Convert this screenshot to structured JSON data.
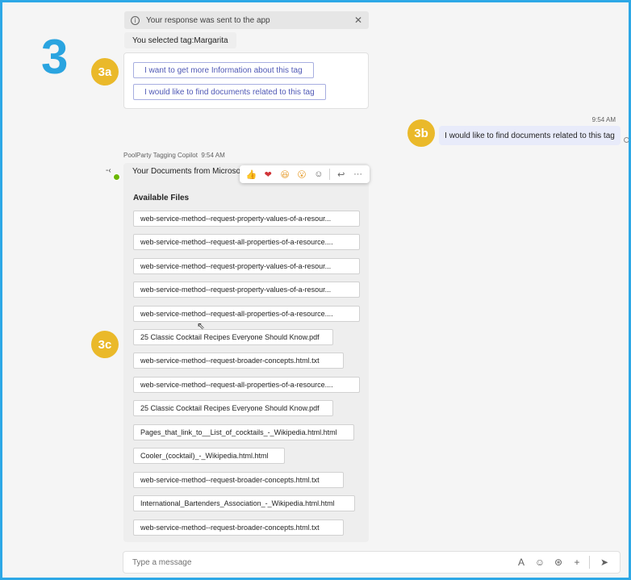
{
  "step": {
    "number": "3",
    "badges": {
      "a": "3a",
      "b": "3b",
      "c": "3c"
    }
  },
  "notice": {
    "text": "Your response was sent to the app"
  },
  "selected_tag": "You selected tag:Margarita",
  "card_actions": [
    "I want to get more Information about this tag",
    "I would like to find documents related to this tag"
  ],
  "user_message": {
    "timestamp": "9:54 AM",
    "text": "I would like to find documents related to this tag"
  },
  "bot_message": {
    "sender": "PoolParty Tagging Copilot",
    "timestamp": "9:54 AM",
    "intro": "Your Documents from Microsoft",
    "files_title": "Available Files",
    "files": [
      "web-service-method--request-property-values-of-a-resour...",
      "web-service-method--request-all-properties-of-a-resource....",
      "web-service-method--request-property-values-of-a-resour...",
      "web-service-method--request-property-values-of-a-resour...",
      "web-service-method--request-all-properties-of-a-resource....",
      "25 Classic Cocktail Recipes Everyone Should Know.pdf",
      "web-service-method--request-broader-concepts.html.txt",
      "web-service-method--request-all-properties-of-a-resource....",
      "25 Classic Cocktail Recipes Everyone Should Know.pdf",
      "Pages_that_link_to__List_of_cocktails_-_Wikipedia.html.html",
      "Cooler_(cocktail)_-_Wikipedia.html.html",
      "web-service-method--request-broader-concepts.html.txt",
      "International_Bartenders_Association_-_Wikipedia.html.html",
      "web-service-method--request-broader-concepts.html.txt"
    ]
  },
  "reactions": [
    "like-icon",
    "heart-icon",
    "laugh-icon",
    "surprised-icon",
    "add-reaction-icon",
    "reply-icon",
    "more-options-icon"
  ],
  "composer": {
    "placeholder": "Type a message"
  },
  "colors": {
    "accent": "#4f58b5",
    "badge": "#eab92a",
    "frame": "#2da8e6",
    "step": "#2aa4e0"
  }
}
